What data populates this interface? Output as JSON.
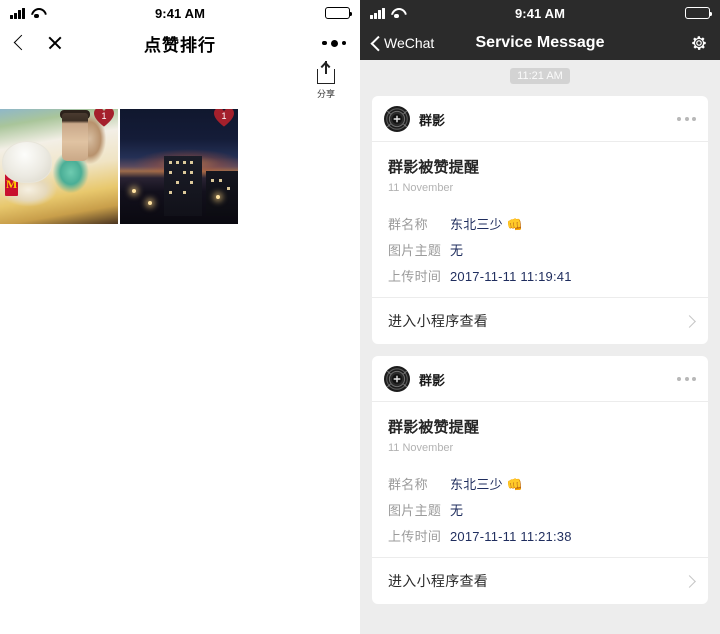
{
  "left": {
    "status": {
      "time": "9:41 AM",
      "signal_icon": "signal-bars-icon",
      "wifi_icon": "wifi-icon",
      "battery_icon": "battery-icon"
    },
    "nav": {
      "back_icon": "chevron-left-icon",
      "close_icon": "close-icon",
      "title": "点赞排行",
      "more_icon": "more-dots-icon"
    },
    "share": {
      "icon": "share-upload-icon",
      "label": "分享"
    },
    "thumbnails": [
      {
        "alt": "photo-food",
        "badge": "1",
        "badge_icon": "heart-badge-icon"
      },
      {
        "alt": "photo-night-city",
        "badge": "1",
        "badge_icon": "heart-badge-icon"
      }
    ]
  },
  "right": {
    "status": {
      "time": "9:41 AM",
      "signal_icon": "signal-bars-icon",
      "wifi_icon": "wifi-icon",
      "battery_icon": "battery-icon"
    },
    "nav": {
      "back_icon": "chevron-left-icon",
      "back_label": "WeChat",
      "title": "Service Message",
      "settings_icon": "gear-icon"
    },
    "timestamp_chip": "11:21 AM",
    "messages": [
      {
        "avatar_icon": "camera-lens-avatar-icon",
        "app_name": "群影",
        "menu_icon": "more-dots-icon",
        "title": "群影被赞提醒",
        "date": "11 November",
        "fields": [
          {
            "key": "群名称",
            "value": "东北三少 👊"
          },
          {
            "key": "图片主题",
            "value": "无"
          },
          {
            "key": "上传时间",
            "value": "2017-11-11 11:19:41"
          }
        ],
        "footer_label": "进入小程序查看",
        "footer_icon": "chevron-right-icon"
      },
      {
        "avatar_icon": "camera-lens-avatar-icon",
        "app_name": "群影",
        "menu_icon": "more-dots-icon",
        "title": "群影被赞提醒",
        "date": "11 November",
        "fields": [
          {
            "key": "群名称",
            "value": "东北三少 👊"
          },
          {
            "key": "图片主题",
            "value": "无"
          },
          {
            "key": "上传时间",
            "value": "2017-11-11 11:21:38"
          }
        ],
        "footer_label": "进入小程序查看",
        "footer_icon": "chevron-right-icon"
      }
    ]
  },
  "colors": {
    "nav_dark": "#2b2b2b",
    "chat_bg": "#ededed",
    "card_white": "#ffffff",
    "value_blue": "#1f2d5e",
    "key_gray": "#9b9b9b",
    "badge_red": "#a4202c"
  }
}
